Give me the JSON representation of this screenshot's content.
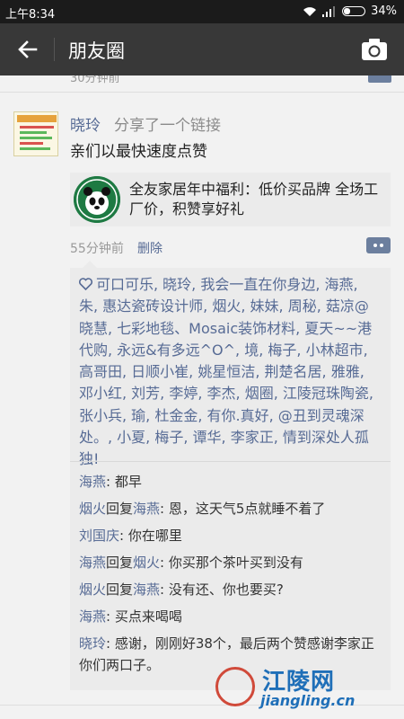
{
  "status_bar": {
    "time": "上午8:34",
    "battery": "34%",
    "battery_level": 0.34
  },
  "nav": {
    "title": "朋友圈"
  },
  "previous_post": {
    "time": "30分钟前"
  },
  "post": {
    "author": "晓玲",
    "action": "分享了一个链接",
    "text": "亲们以最快速度点赞",
    "link": {
      "title": "全友家居年中福利：低价买品牌 全场工厂价，积赞享好礼"
    },
    "time_ago": "55分钟前",
    "delete_label": "删除",
    "likes_text": "可口可乐, 晓玲, 我会一直在你身边, 海燕, 朱, 惠达瓷砖设计师, 烟火, 妹妹, 周秘, 菇凉@晓慧, 七彩地毯、Mosaic装饰材料, 夏天~~港代购, 永远&有多远^O^, 境, 梅子, 小林超市, 高哥田, 日顺小崔, 姚星恒洁, 荆楚名居, 雅雅, 邓小红, 刘芳, 李婷, 李杰, 烟圈, 江陵冠珠陶瓷, 张小兵, 瑜, 杜金金, 有你.真好, @丑到灵魂深处。, 小夏, 梅子, 谭华, 李家正, 情到深处人孤独!",
    "comments": [
      {
        "name": "海燕",
        "reply_word": "",
        "reply_to": "",
        "text": ": 都早"
      },
      {
        "name": "烟火",
        "reply_word": "回复",
        "reply_to": "海燕",
        "text": ": 恩，这天气5点就睡不着了"
      },
      {
        "name": "刘国庆",
        "reply_word": "",
        "reply_to": "",
        "text": ": 你在哪里"
      },
      {
        "name": "海燕",
        "reply_word": "回复",
        "reply_to": "烟火",
        "text": ": 你买那个茶叶买到没有"
      },
      {
        "name": "烟火",
        "reply_word": "回复",
        "reply_to": "海燕",
        "text": ": 没有还、你也要买?"
      },
      {
        "name": "海燕",
        "reply_word": "",
        "reply_to": "",
        "text": ": 买点来喝喝"
      },
      {
        "name": "晓玲",
        "reply_word": "",
        "reply_to": "",
        "text": ": 感谢，刚刚好38个，最后两个赞感谢李家正你们两口子。"
      }
    ]
  },
  "watermark": {
    "name": "江陵网",
    "url": "jiangling.cn"
  }
}
